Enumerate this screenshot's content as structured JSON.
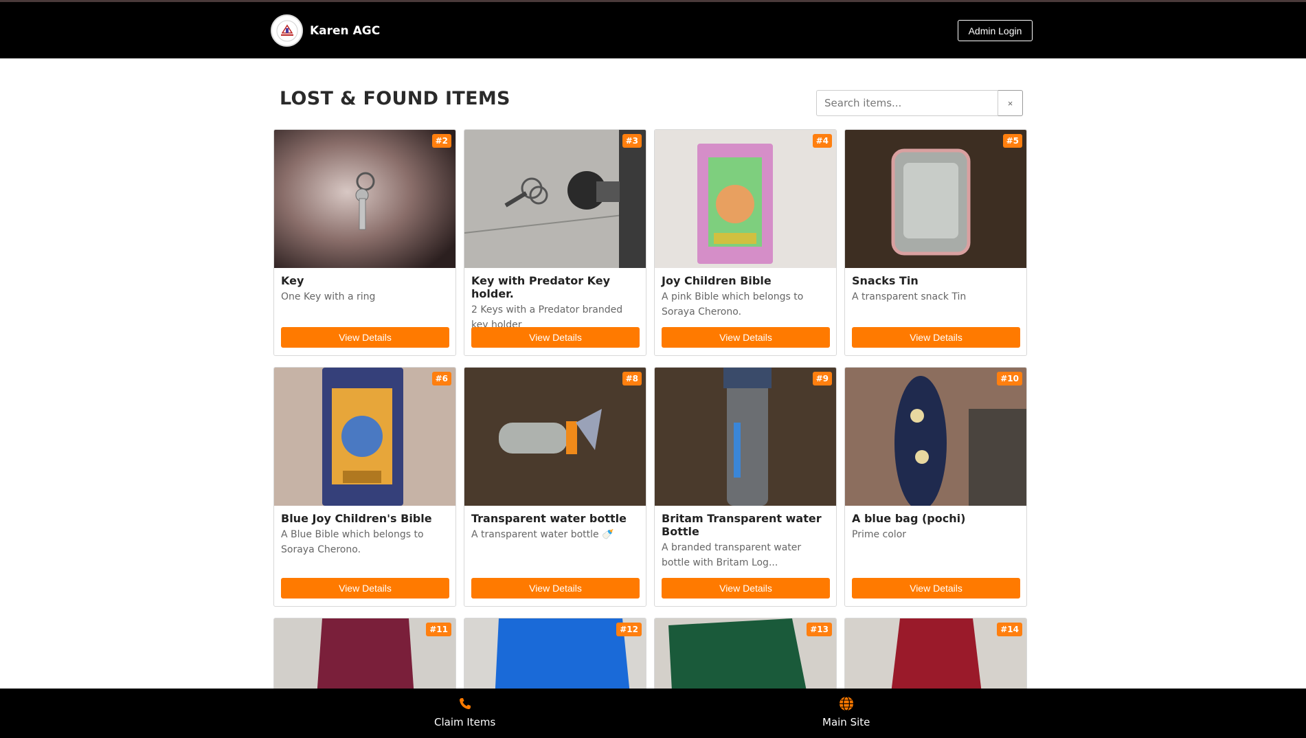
{
  "brand": {
    "name": "Karen AGC"
  },
  "header": {
    "admin_login": "Admin Login"
  },
  "page": {
    "title": "LOST & FOUND ITEMS"
  },
  "search": {
    "placeholder": "Search items...",
    "clear": "×"
  },
  "colors": {
    "accent": "#ff7a00",
    "navbar": "#000000"
  },
  "items": [
    {
      "id": "#2",
      "title": "Key",
      "desc": "One Key with a ring",
      "button": "View Details"
    },
    {
      "id": "#3",
      "title": "Key with Predator Key holder.",
      "desc": "2 Keys with a Predator branded key holder",
      "button": "View Details"
    },
    {
      "id": "#4",
      "title": "Joy Children Bible",
      "desc": "A pink Bible which belongs to Soraya Cherono.",
      "button": "View Details"
    },
    {
      "id": "#5",
      "title": "Snacks Tin",
      "desc": "A transparent snack Tin",
      "button": "View Details"
    },
    {
      "id": "#6",
      "title": "Blue Joy Children's Bible",
      "desc": "A Blue Bible which belongs to Soraya Cherono.",
      "button": "View Details"
    },
    {
      "id": "#8",
      "title": "Transparent water bottle",
      "desc": "A transparent water bottle 🍼",
      "button": "View Details"
    },
    {
      "id": "#9",
      "title": "Britam Transparent water Bottle",
      "desc": "A branded transparent water bottle with Britam Log...",
      "button": "View Details"
    },
    {
      "id": "#10",
      "title": "A blue bag (pochi)",
      "desc": "Prime color",
      "button": "View Details"
    },
    {
      "id": "#11"
    },
    {
      "id": "#12"
    },
    {
      "id": "#13"
    },
    {
      "id": "#14"
    }
  ],
  "bottom_nav": [
    {
      "label": "Claim Items",
      "icon": "phone-icon"
    },
    {
      "label": "Main Site",
      "icon": "globe-icon"
    }
  ]
}
